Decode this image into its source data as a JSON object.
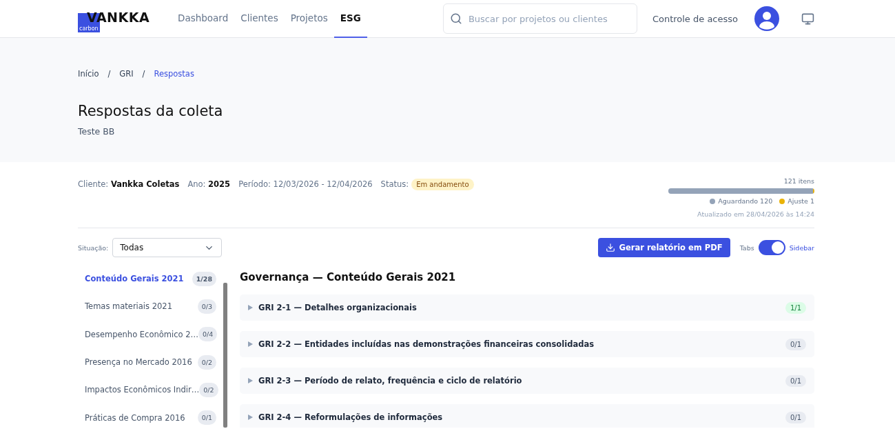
{
  "header": {
    "logo": {
      "name": "VANKKA",
      "sub": "carbon"
    },
    "nav": [
      {
        "label": "Dashboard",
        "selected": false
      },
      {
        "label": "Clientes",
        "selected": false
      },
      {
        "label": "Projetos",
        "selected": false
      },
      {
        "label": "ESG",
        "selected": true
      }
    ],
    "search": {
      "placeholder": "Buscar por projetos ou clientes"
    },
    "access_link": "Controle de acesso"
  },
  "breadcrumb": [
    {
      "label": "Início",
      "selected": false
    },
    {
      "label": "GRI",
      "selected": false
    },
    {
      "label": "Respostas",
      "selected": true
    }
  ],
  "breadcrumb_separator": "/",
  "title": "Respostas da coleta",
  "subtitle": "Teste BB",
  "info": [
    {
      "label": "Cliente:",
      "value": "Vankka Coletas",
      "bold": true
    },
    {
      "label": "Ano:",
      "value": "2025",
      "bold": true
    },
    {
      "label": "Período:",
      "value": "12/03/2026 - 12/04/2026",
      "bold": false
    }
  ],
  "status": {
    "label": "Status:",
    "value": "Em andamento"
  },
  "progress": {
    "total": "121 itens",
    "segments": [
      {
        "label": "Aguardando 120",
        "color": "#94a3b8",
        "level": 0.99
      },
      {
        "label": "Ajuste 1",
        "color": "#eab308",
        "level": 0.01
      }
    ],
    "updated": "Atualizado em 28/04/2026 às 14:24"
  },
  "filter": {
    "label": "Situação:",
    "value": "Todas"
  },
  "pdf_button": "Gerar relatório em PDF",
  "view_toggle": {
    "left": "Tabs",
    "right": "Sidebar",
    "on": true
  },
  "sidebar": [
    {
      "label": "Conteúdo Gerais 2021",
      "count": "1/28",
      "selected": true
    },
    {
      "label": "Temas materiais 2021",
      "count": "0/3",
      "selected": false
    },
    {
      "label": "Desempenho Econômico 2…",
      "count": "0/4",
      "selected": false
    },
    {
      "label": "Presença no Mercado 2016",
      "count": "0/2",
      "selected": false
    },
    {
      "label": "Impactos Econômicos Indir…",
      "count": "0/2",
      "selected": false
    },
    {
      "label": "Práticas de Compra 2016",
      "count": "0/1",
      "selected": false
    }
  ],
  "section_title": "Governança — Conteúdo Gerais 2021",
  "items": [
    {
      "code": "GRI 2-1",
      "title": "— Detalhes organizacionais",
      "count": "1/1",
      "complete": true,
      "expanded": false
    },
    {
      "code": "GRI 2-2",
      "title": "— Entidades incluídas nas demonstrações financeiras consolidadas",
      "count": "0/1",
      "complete": false,
      "expanded": false
    },
    {
      "code": "GRI 2-3",
      "title": "— Período de relato, frequência e ciclo de relatório",
      "count": "0/1",
      "complete": false,
      "expanded": false
    },
    {
      "code": "GRI 2-4",
      "title": "— Reformulações de informações",
      "count": "0/1",
      "complete": false,
      "expanded": false
    }
  ]
}
